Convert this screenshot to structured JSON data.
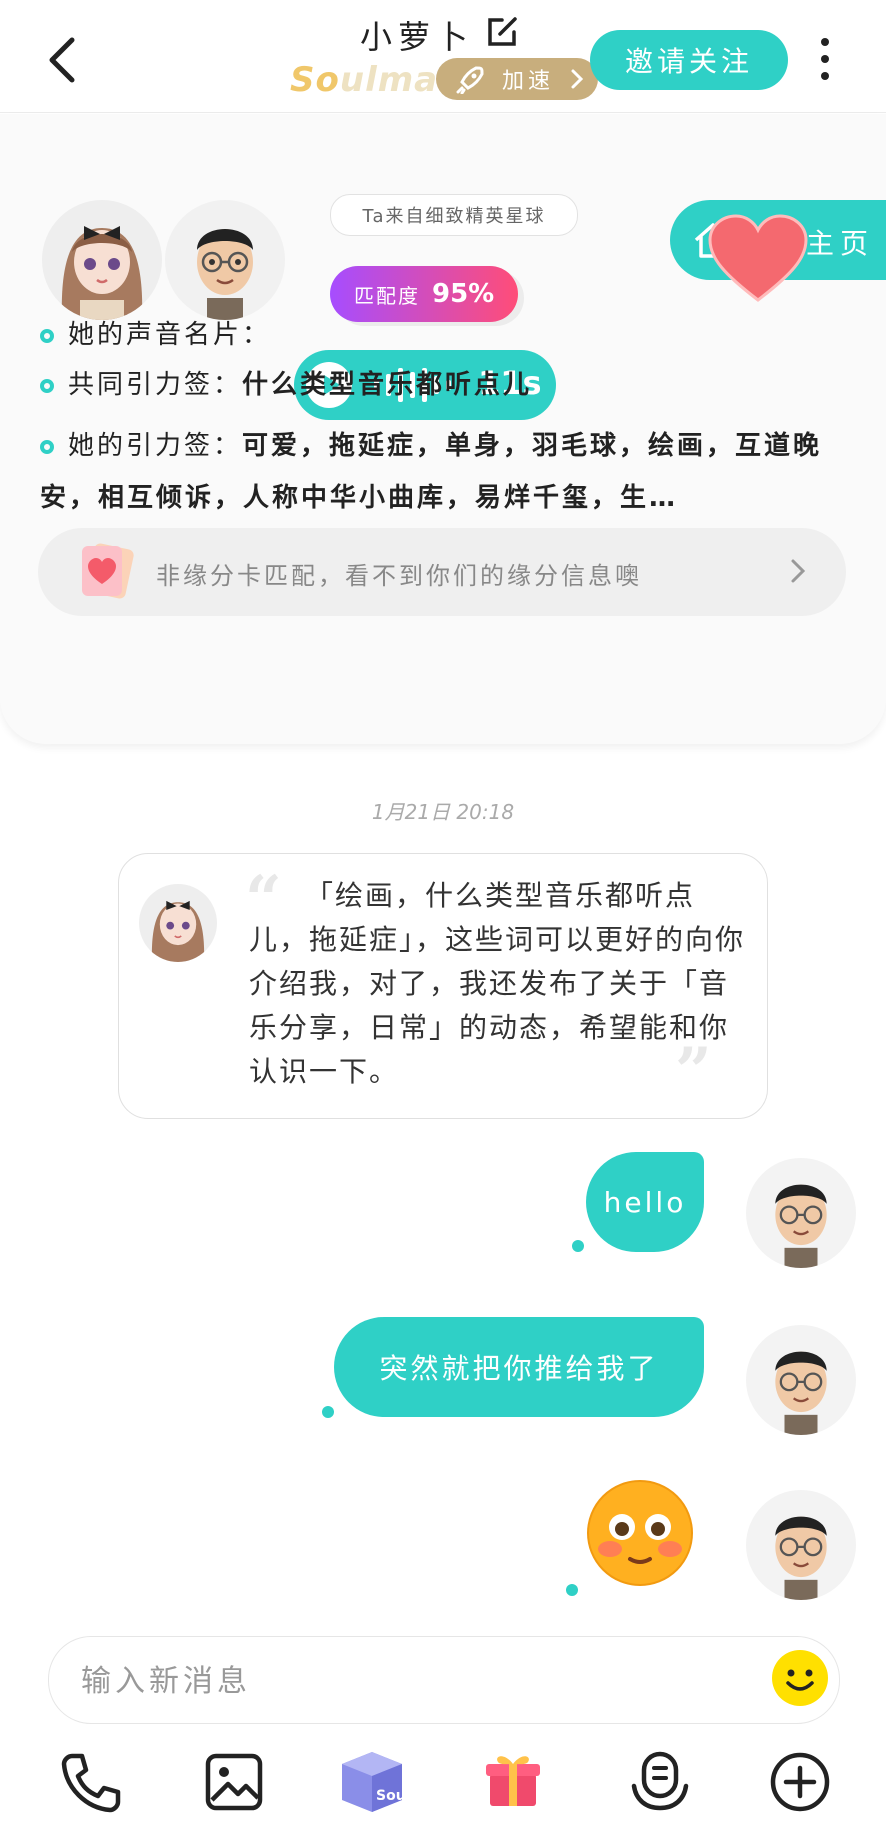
{
  "header": {
    "title": "小萝卜",
    "brand_prefix": "So",
    "brand_rest": "ulmate",
    "speed_label": "加速",
    "invite_label": "邀请关注"
  },
  "match_card": {
    "origin": "Ta来自细致精英星球",
    "match_label": "匹配度",
    "match_value": "95%",
    "home_label": "主页",
    "voice_label": "她的声音名片：",
    "voice_duration": "11s",
    "common_label": "共同引力签：",
    "common_value": "什么类型音乐都听点儿",
    "her_tags_label": "她的引力签：",
    "her_tags_value": "可爱，拖延症，单身，羽毛球，绘画，互道晚安，相互倾诉，人称中华小曲库，易烊千玺，生…",
    "notice": "非缘分卡匹配，看不到你们的缘分信息噢"
  },
  "chat": {
    "timestamp": "1月21日 20:18",
    "intro_message": "「绘画，什么类型音乐都听点儿，拖延症」，这些词可以更好的向你介绍我，对了，我还发布了关于「音乐分享，日常」的动态，希望能和你认识一下。",
    "messages": [
      {
        "from": "me",
        "type": "text",
        "text": "hello"
      },
      {
        "from": "me",
        "type": "text",
        "text": "突然就把你推给我了"
      },
      {
        "from": "me",
        "type": "emoji",
        "emoji": "flushed-face"
      }
    ]
  },
  "composer": {
    "placeholder": "输入新消息"
  },
  "toolbar": {
    "icons": [
      "phone-icon",
      "image-icon",
      "soul-box-icon",
      "gift-icon",
      "voice-match-icon",
      "plus-icon"
    ],
    "box_label": "Soul"
  },
  "colors": {
    "accent": "#2fd0c6",
    "gold": "#c8ae7d",
    "match_gradient_start": "#a64dff",
    "match_gradient_end": "#ff4d78"
  }
}
